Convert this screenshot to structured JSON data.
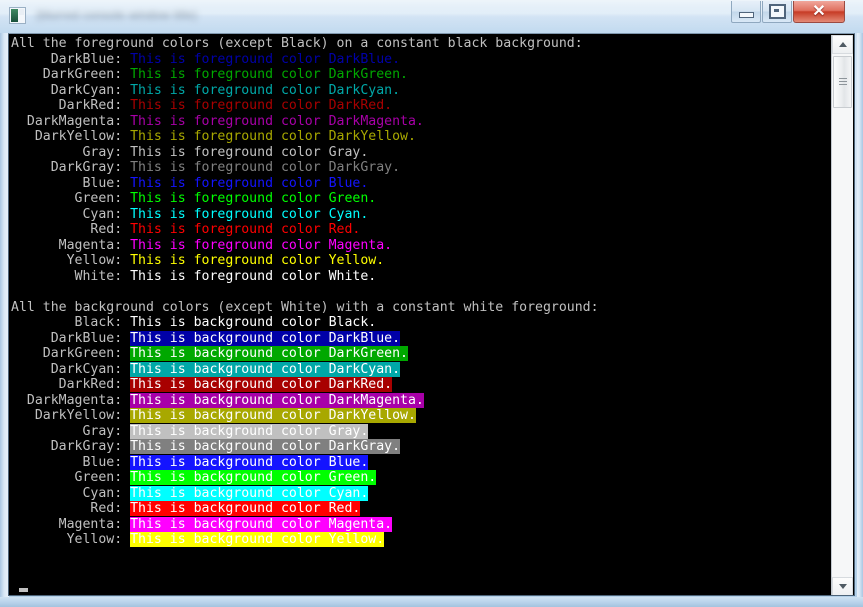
{
  "window": {
    "title": "(blurred console window title)",
    "icon": "console-app-icon",
    "buttons": {
      "minimize": "Minimize",
      "maximize": "Maximize",
      "close": "Close",
      "close_symbol": "✕"
    }
  },
  "console": {
    "background": "#000000",
    "default_foreground": "#c0c0c0",
    "palette": {
      "Black": "#000000",
      "DarkBlue": "#0000a8",
      "DarkGreen": "#00a800",
      "DarkCyan": "#00a8a8",
      "DarkRed": "#a80000",
      "DarkMagenta": "#a800a8",
      "DarkYellow": "#a8a800",
      "Gray": "#c0c0c0",
      "DarkGray": "#808080",
      "Blue": "#1414ff",
      "Green": "#00ff00",
      "Cyan": "#00ffff",
      "Red": "#ff0000",
      "Magenta": "#ff00ff",
      "Yellow": "#ffff00",
      "White": "#ffffff"
    },
    "sections": [
      {
        "heading": "All the foreground colors (except Black) on a constant black background:",
        "mode": "foreground",
        "line_template": "This is foreground color {name}.",
        "rows": [
          {
            "label": "DarkBlue",
            "color": "DarkBlue"
          },
          {
            "label": "DarkGreen",
            "color": "DarkGreen"
          },
          {
            "label": "DarkCyan",
            "color": "DarkCyan"
          },
          {
            "label": "DarkRed",
            "color": "DarkRed"
          },
          {
            "label": "DarkMagenta",
            "color": "DarkMagenta"
          },
          {
            "label": "DarkYellow",
            "color": "DarkYellow"
          },
          {
            "label": "Gray",
            "color": "Gray"
          },
          {
            "label": "DarkGray",
            "color": "DarkGray"
          },
          {
            "label": "Blue",
            "color": "Blue"
          },
          {
            "label": "Green",
            "color": "Green"
          },
          {
            "label": "Cyan",
            "color": "Cyan"
          },
          {
            "label": "Red",
            "color": "Red"
          },
          {
            "label": "Magenta",
            "color": "Magenta"
          },
          {
            "label": "Yellow",
            "color": "Yellow"
          },
          {
            "label": "White",
            "color": "White"
          }
        ]
      },
      {
        "heading": "All the background colors (except White) with a constant white foreground:",
        "mode": "background",
        "line_template": "This is background color {name}.",
        "text_color": "White",
        "rows": [
          {
            "label": "Black",
            "color": "Black"
          },
          {
            "label": "DarkBlue",
            "color": "DarkBlue"
          },
          {
            "label": "DarkGreen",
            "color": "DarkGreen"
          },
          {
            "label": "DarkCyan",
            "color": "DarkCyan"
          },
          {
            "label": "DarkRed",
            "color": "DarkRed"
          },
          {
            "label": "DarkMagenta",
            "color": "DarkMagenta"
          },
          {
            "label": "DarkYellow",
            "color": "DarkYellow"
          },
          {
            "label": "Gray",
            "color": "Gray"
          },
          {
            "label": "DarkGray",
            "color": "DarkGray"
          },
          {
            "label": "Blue",
            "color": "Blue"
          },
          {
            "label": "Green",
            "color": "Green"
          },
          {
            "label": "Cyan",
            "color": "Cyan"
          },
          {
            "label": "Red",
            "color": "Red"
          },
          {
            "label": "Magenta",
            "color": "Magenta"
          },
          {
            "label": "Yellow",
            "color": "Yellow"
          }
        ]
      }
    ],
    "label_field_width": 13,
    "cursor_visible": true
  },
  "scrollbar": {
    "up_arrow": "▲",
    "down_arrow": "▼",
    "thumb_position_pct": 4,
    "thumb_size_pct": 10
  }
}
